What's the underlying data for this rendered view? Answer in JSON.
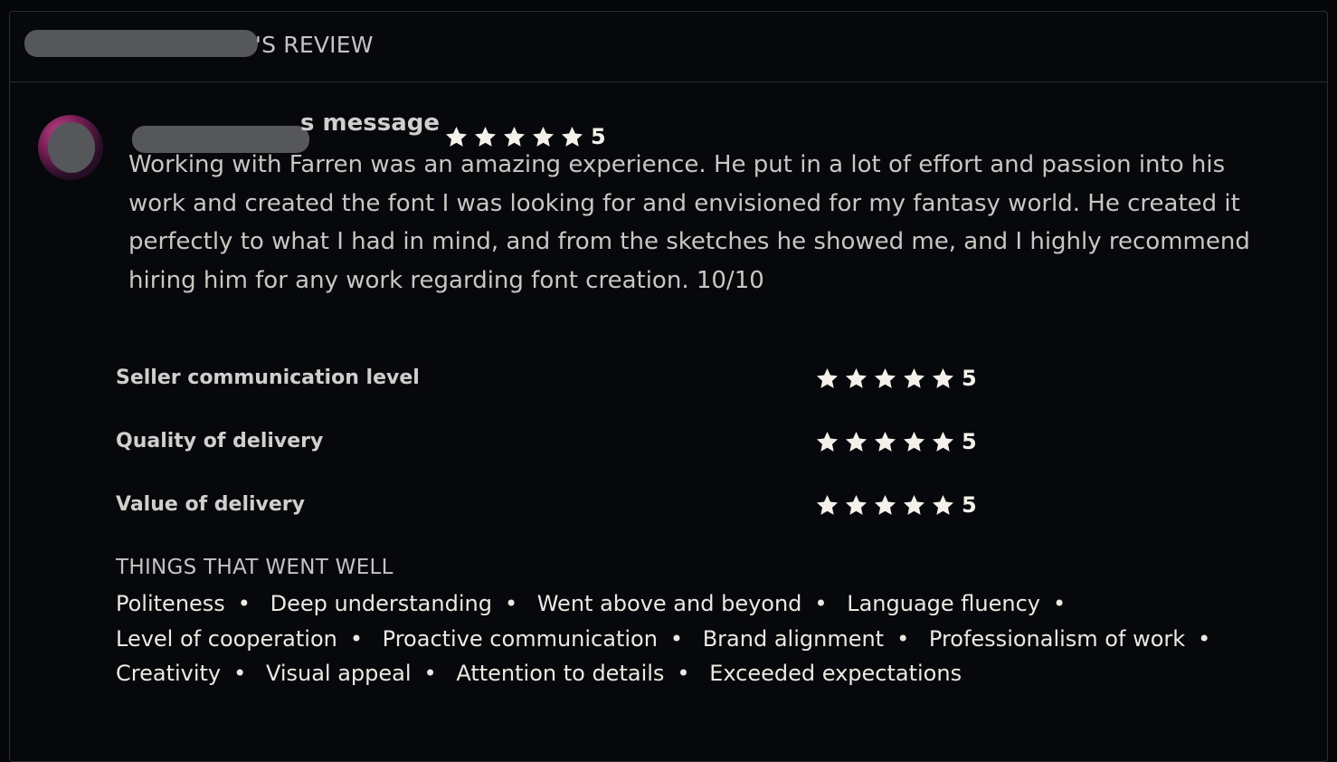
{
  "header": {
    "title_suffix": "'S REVIEW"
  },
  "review": {
    "title_suffix": "s message",
    "rating": "5",
    "stars": 5,
    "text": "Working with Farren was an amazing experience. He put in a lot of effort and passion into his work and created the font I was looking for and envisioned for my fantasy world. He created it perfectly to what I had in mind, and from the sketches he showed me, and I highly recommend hiring him for any work regarding font creation. 10/10"
  },
  "categories": [
    {
      "label": "Seller communication level",
      "rating": "5",
      "stars": 5
    },
    {
      "label": "Quality of delivery",
      "rating": "5",
      "stars": 5
    },
    {
      "label": "Value of delivery",
      "rating": "5",
      "stars": 5
    }
  ],
  "went_well": {
    "title": "THINGS THAT WENT WELL",
    "tags": [
      "Politeness",
      "Deep understanding",
      "Went above and beyond",
      "Language fluency",
      "Level of cooperation",
      "Proactive communication",
      "Brand alignment",
      "Professionalism of work",
      "Creativity",
      "Visual appeal",
      "Attention to details",
      "Exceeded expectations"
    ],
    "separator": "•"
  },
  "colors": {
    "star": "#f4f1ea",
    "background": "#07080b",
    "border": "#2c2d30"
  },
  "icons": {
    "star": "star-icon",
    "avatar": "user-avatar"
  }
}
